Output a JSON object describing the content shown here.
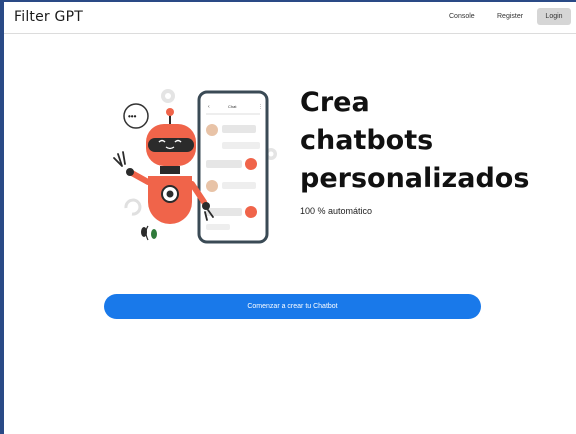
{
  "header": {
    "brand": "Filter GPT",
    "nav": {
      "console": "Console",
      "register": "Register",
      "login": "Login"
    }
  },
  "hero": {
    "title_lines": [
      "Crea",
      "chatbots",
      "personalizados"
    ],
    "subtitle": "100 % automático",
    "chat_header": "Chat",
    "speech_dots": "•••"
  },
  "cta": {
    "label": "Comenzar a crear tu Chatbot"
  },
  "colors": {
    "accent": "#1979ea",
    "robot": "#f0644a",
    "robot_dark": "#2b2b2b",
    "phone_frame": "#3a4a55",
    "page_border": "#2a4a86"
  }
}
